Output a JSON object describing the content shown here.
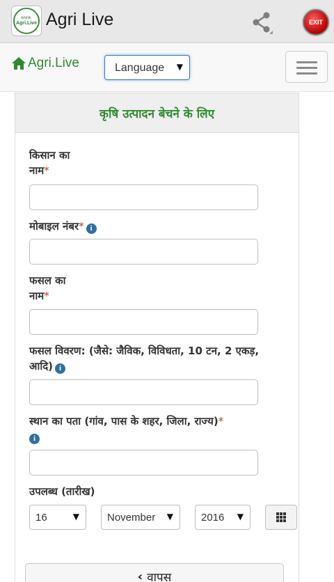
{
  "app_bar": {
    "logo_text": "Agri.Live",
    "logo_dots": "www.",
    "title": "Agri Live",
    "share_icon": "share-icon",
    "exit_label": "EXIT"
  },
  "navbar": {
    "brand": "Agri.Live",
    "brand_icon": "home-icon",
    "language_select": "Language",
    "menu_icon": "hamburger-menu-icon"
  },
  "panel": {
    "heading": "कृषि उत्पादन बेचने के लिए"
  },
  "form": {
    "farmer_name": {
      "label_line1": "किसान का",
      "label_line2": "नाम",
      "required_mark": "*",
      "value": ""
    },
    "mobile": {
      "label": "मोबाइल नंबर",
      "required_mark": "*",
      "info": "i",
      "value": ""
    },
    "crop_name": {
      "label_line1": "फसल का",
      "label_line2": "नाम",
      "required_mark": "*",
      "value": ""
    },
    "crop_details": {
      "label_line1": "फसल विवरण: (जैसे: जैविक, विविधता, 10 टन, 2 एकड़,",
      "label_line2": "आदि)",
      "info": "i",
      "value": ""
    },
    "address": {
      "label": "स्थान का पता (गांव, पास के शहर, जिला, राज्य)",
      "required_mark": "*",
      "info": "i",
      "value": ""
    },
    "available": {
      "label": "उपलब्ध (तारीख)",
      "day": "16",
      "month": "November",
      "year": "2016",
      "calendar_icon": "calendar-grid-icon"
    }
  },
  "back_button": {
    "icon": "chevron-left-icon",
    "label": "वापस"
  },
  "colors": {
    "brand_green": "#2e8b2e",
    "required_red": "#c0392b",
    "info_blue": "#2f6f9f",
    "select_focus_blue": "#2b78c2",
    "exit_red": "#b30000"
  }
}
